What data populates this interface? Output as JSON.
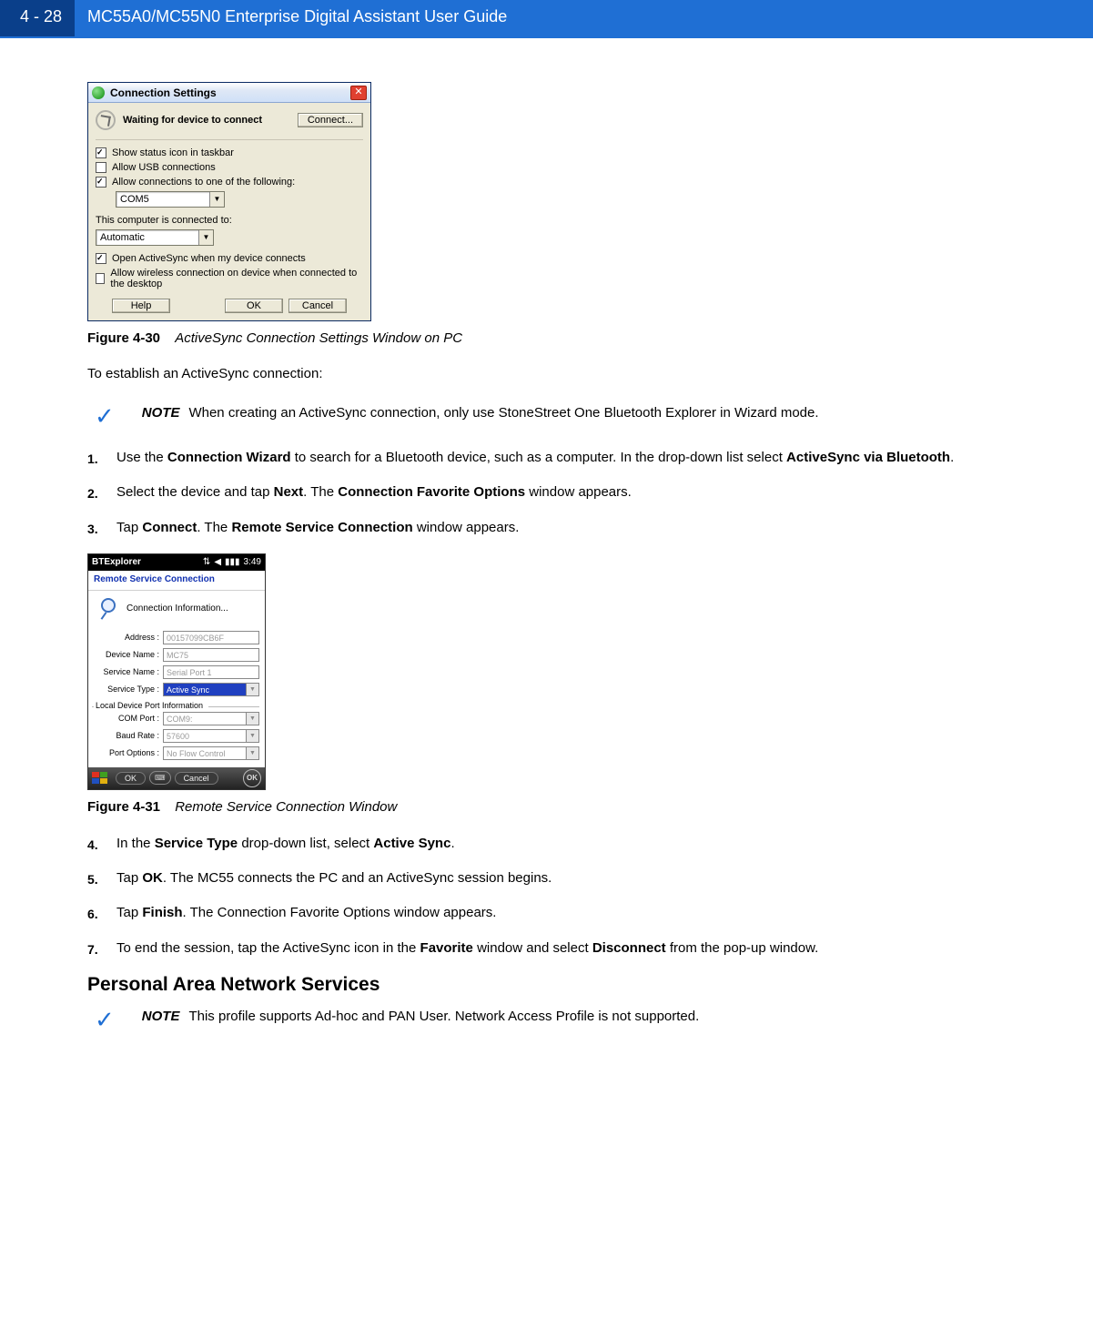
{
  "header": {
    "pageNumber": "4 - 28",
    "title": "MC55A0/MC55N0 Enterprise Digital Assistant User Guide"
  },
  "figure430": {
    "windowTitle": "Connection Settings",
    "waitMsg": "Waiting for device to connect",
    "connectBtn": "Connect...",
    "chk1": "Show status icon in taskbar",
    "chk2": "Allow USB connections",
    "chk3": "Allow connections to one of the following:",
    "com": "COM5",
    "connectedLabel": "This computer is connected to:",
    "connectedVal": "Automatic",
    "chk4": "Open ActiveSync when my device connects",
    "chk5": "Allow wireless connection on device when connected to the desktop",
    "helpBtn": "Help",
    "okBtn": "OK",
    "cancelBtn": "Cancel",
    "captionLabel": "Figure 4-30",
    "captionDesc": "ActiveSync Connection Settings Window on PC"
  },
  "introText": "To establish an ActiveSync connection:",
  "note1": {
    "label": "NOTE",
    "text": "When creating an ActiveSync connection, only use StoneStreet One Bluetooth Explorer in Wizard mode."
  },
  "steps": {
    "s1a": "Use the ",
    "s1b": "Connection Wizard",
    "s1c": " to search for a Bluetooth device, such as a computer. In the drop-down list select ",
    "s1d": "ActiveSync via Bluetooth",
    "s1e": ".",
    "s2a": "Select the device and tap ",
    "s2b": "Next",
    "s2c": ". The ",
    "s2d": "Connection Favorite Options",
    "s2e": " window appears.",
    "s3a": "Tap ",
    "s3b": "Connect",
    "s3c": ". The ",
    "s3d": "Remote Service Connection",
    "s3e": " window appears.",
    "s4a": "In the ",
    "s4b": "Service Type",
    "s4c": " drop-down list, select ",
    "s4d": "Active Sync",
    "s4e": ".",
    "s5a": "Tap ",
    "s5b": "OK",
    "s5c": ". The MC55 connects the PC and an ActiveSync session begins.",
    "s6a": "Tap ",
    "s6b": "Finish",
    "s6c": ". The Connection Favorite Options window appears.",
    "s7a": "To end the session, tap the ActiveSync icon in the ",
    "s7b": "Favorite",
    "s7c": " window and select ",
    "s7d": "Disconnect",
    "s7e": " from the pop-up window."
  },
  "figure431": {
    "barTitle": "BTExplorer",
    "barTime": "3:49",
    "rscTitle": "Remote Service Connection",
    "connInfo": "Connection Information...",
    "addressLbl": "Address :",
    "addressVal": "00157099CB6F",
    "deviceLbl": "Device Name :",
    "deviceVal": "MC75",
    "serviceNameLbl": "Service Name :",
    "serviceNameVal": "Serial Port 1",
    "serviceTypeLbl": "Service Type :",
    "serviceTypeVal": "Active Sync",
    "localLabel": "Local Device Port Information",
    "comPortLbl": "COM Port :",
    "comPortVal": "COM9:",
    "baudLbl": "Baud Rate :",
    "baudVal": "57600",
    "portOptLbl": "Port Options :",
    "portOptVal": "No Flow Control",
    "tbOk": "OK",
    "tbCancel": "Cancel",
    "tbOkCircle": "OK",
    "captionLabel": "Figure 4-31",
    "captionDesc": "Remote Service Connection Window"
  },
  "sectionHeading": "Personal Area Network Services",
  "note2": {
    "label": "NOTE",
    "text": "This profile supports Ad-hoc and PAN User. Network Access Profile is not supported."
  },
  "nums": {
    "n1": "1.",
    "n2": "2.",
    "n3": "3.",
    "n4": "4.",
    "n5": "5.",
    "n6": "6.",
    "n7": "7."
  }
}
